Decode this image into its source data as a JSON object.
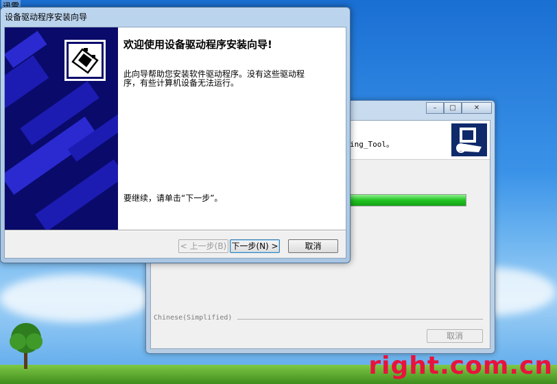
{
  "desktop": {
    "top_label": "迅雷",
    "watermark": "right.com.cn"
  },
  "back_window": {
    "controls": {
      "minimize": "–",
      "maximize": "□",
      "close": "✕"
    },
    "header_text": "ing_Tool。",
    "progress_percent": 100,
    "language_label": "Chinese(Simplified)",
    "cancel_label": "取消"
  },
  "front_window": {
    "title": "设备驱动程序安装向导",
    "heading": "欢迎使用设备驱动程序安装向导!",
    "description": "此向导帮助您安装软件驱动程序。没有这些驱动程序，有些计算机设备无法运行。",
    "continue_text": "要继续，请单击“下一步”。",
    "buttons": {
      "back": "< 上一步(B)",
      "next": "下一步(N) >",
      "cancel": "取消"
    }
  },
  "colors": {
    "side_art_dark": "#0a0a6b",
    "side_art_light": "#1c1cb3",
    "progress_green": "#22c322",
    "watermark": "#e8133c"
  }
}
